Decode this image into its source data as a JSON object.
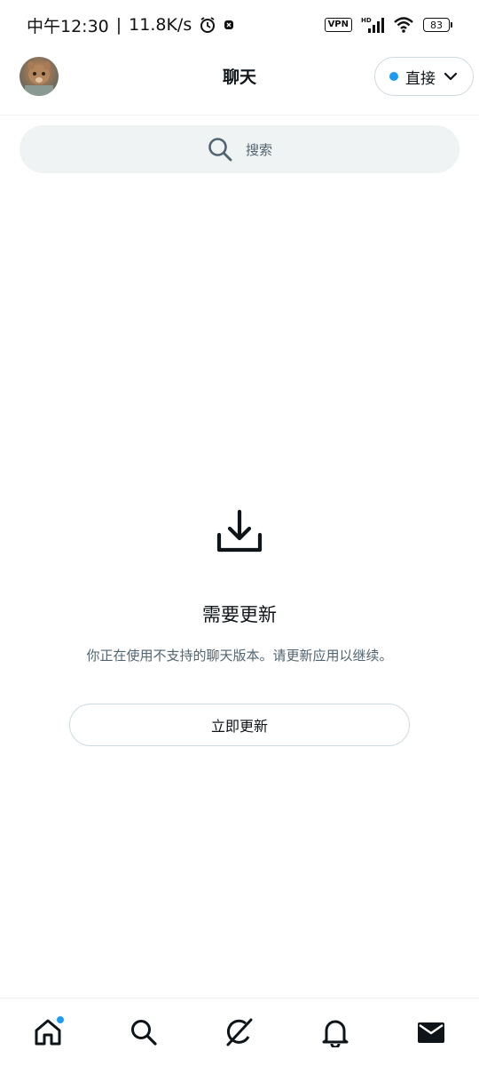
{
  "status_bar": {
    "time": "中午12:30",
    "speed": "11.8K/s",
    "vpn": "VPN",
    "hd": "HD",
    "battery": "83"
  },
  "header": {
    "title": "聊天",
    "filter_label": "直接"
  },
  "search": {
    "placeholder": "搜索"
  },
  "empty_state": {
    "title": "需要更新",
    "description": "你正在使用不支持的聊天版本。请更新应用以继续。",
    "button_label": "立即更新"
  },
  "colors": {
    "accent": "#1d9bf0",
    "text_primary": "#0f1419",
    "text_secondary": "#536471",
    "search_bg": "#eff3f4"
  },
  "bottom_nav": {
    "items": [
      "home-icon",
      "search-icon",
      "grok-icon",
      "bell-icon",
      "mail-icon"
    ],
    "home_has_badge": true
  }
}
